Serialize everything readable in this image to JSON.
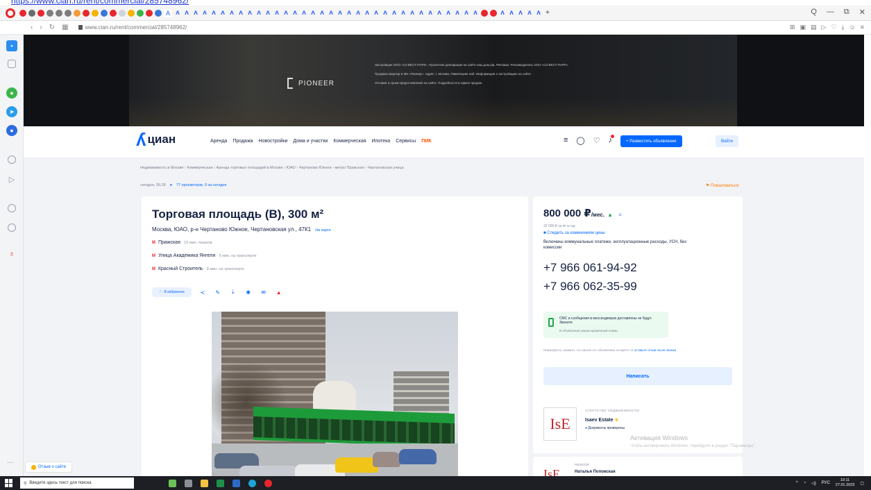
{
  "browser": {
    "top_link": "https://www.cian.ru/rent/commercial/285748962/",
    "address_url": "www.cian.ru/rent/commercial/285748962/",
    "win_controls": [
      "Q",
      "—",
      "⧉",
      "✕"
    ],
    "tab_active": "A"
  },
  "hero": {
    "brand": "PIONEER",
    "lines": [
      "Застройщик ООО «СЗ ВЕСТ-ПАРК». Проектная декларация на сайте наш.дом.рф. Реклама. Рекламодатель ООО «СЗ ВЕСТ-ПАРК».",
      "Продажа квартир в ЖК «Пионер». Адрес: г. Москва, Павелецкая наб. Информация о застройщике на сайте.",
      "Условия и сроки предоставления на сайте. Подробности в офисе продаж."
    ]
  },
  "header": {
    "logo_text": "циан",
    "nav": [
      "Аренда",
      "Продажа",
      "Новостройки",
      "Дома и участки",
      "Коммерческая",
      "Ипотека",
      "Сервисы"
    ],
    "nav_highlight": "ПИК",
    "post_button": "+ Разместить объявление",
    "login_button": "Войти"
  },
  "breadcrumbs": "Недвижимость в Москве  ›  Коммерческая  ›  Аренда торговых площадей в Москве  ›  ЮАО  ›  Чертаново Южное  ›  метро Пражская  ›  Чертановская улица",
  "meta": {
    "updated": "сегодня, 05:28",
    "views": "77 просмотров, 0 за сегодня",
    "report": "Пожаловаться"
  },
  "listing": {
    "title": "Торговая площадь (В), 300 м²",
    "address": "Москва, ЮАО, р-н Чертаново Южное, Чертановская ул., 47К1",
    "on_map": "На карте",
    "metro": [
      {
        "name": "Пражская",
        "time": "· 15 мин. пешком"
      },
      {
        "name": "Улица Академика Янгеля",
        "time": "· 5 мин. на транспорте"
      },
      {
        "name": "Красный Строитель",
        "time": "· 8 мин. на транспорте"
      }
    ],
    "favorite_label": "В избранное"
  },
  "offer": {
    "price": "800 000 ₽",
    "price_unit": "/мес.",
    "per_m2": "32 000 ₽ за м² в год",
    "follow_price": "Следить за изменением цены",
    "included": "Включены коммунальные платежи, эксплуатационные расходы, УСН, без комиссии",
    "phones": [
      "+7 966 061-94-92",
      "+7 966 062-35-99"
    ],
    "sms_title": "СМС и сообщения в мессенджерах доставлены не будут. Звоните",
    "sms_sub": "В объявлении указан временный номер",
    "note_text": "Пожалуйста, скажите, что нашли это объявление на ЦИАН. И",
    "note_link": "оставьте отзыв после звонка",
    "write_button": "Написать"
  },
  "agency": {
    "caption": "АГЕНТСТВО НЕДВИЖИМОСТИ",
    "logo": "IsE",
    "name": "Isaev Estate",
    "docs": "Документы проверены"
  },
  "agent": {
    "caption": "РИЭЛТОР",
    "logo": "IsE",
    "name": "Наталья Поповская"
  },
  "watermark": {
    "title": "Активация Windows",
    "sub": "Чтобы активировать Windows, перейдите в раздел \"Параметры\"."
  },
  "about_site": "Отзыв о сайте",
  "taskbar": {
    "search_placeholder": "Введите здесь текст для поиска",
    "lang": "РУС",
    "time": "10:11",
    "date": "27.01.2023"
  },
  "colors": {
    "accent": "#0468ff",
    "metro": "#e8262d",
    "pik": "#ff4d00",
    "success": "#1fa54a"
  }
}
